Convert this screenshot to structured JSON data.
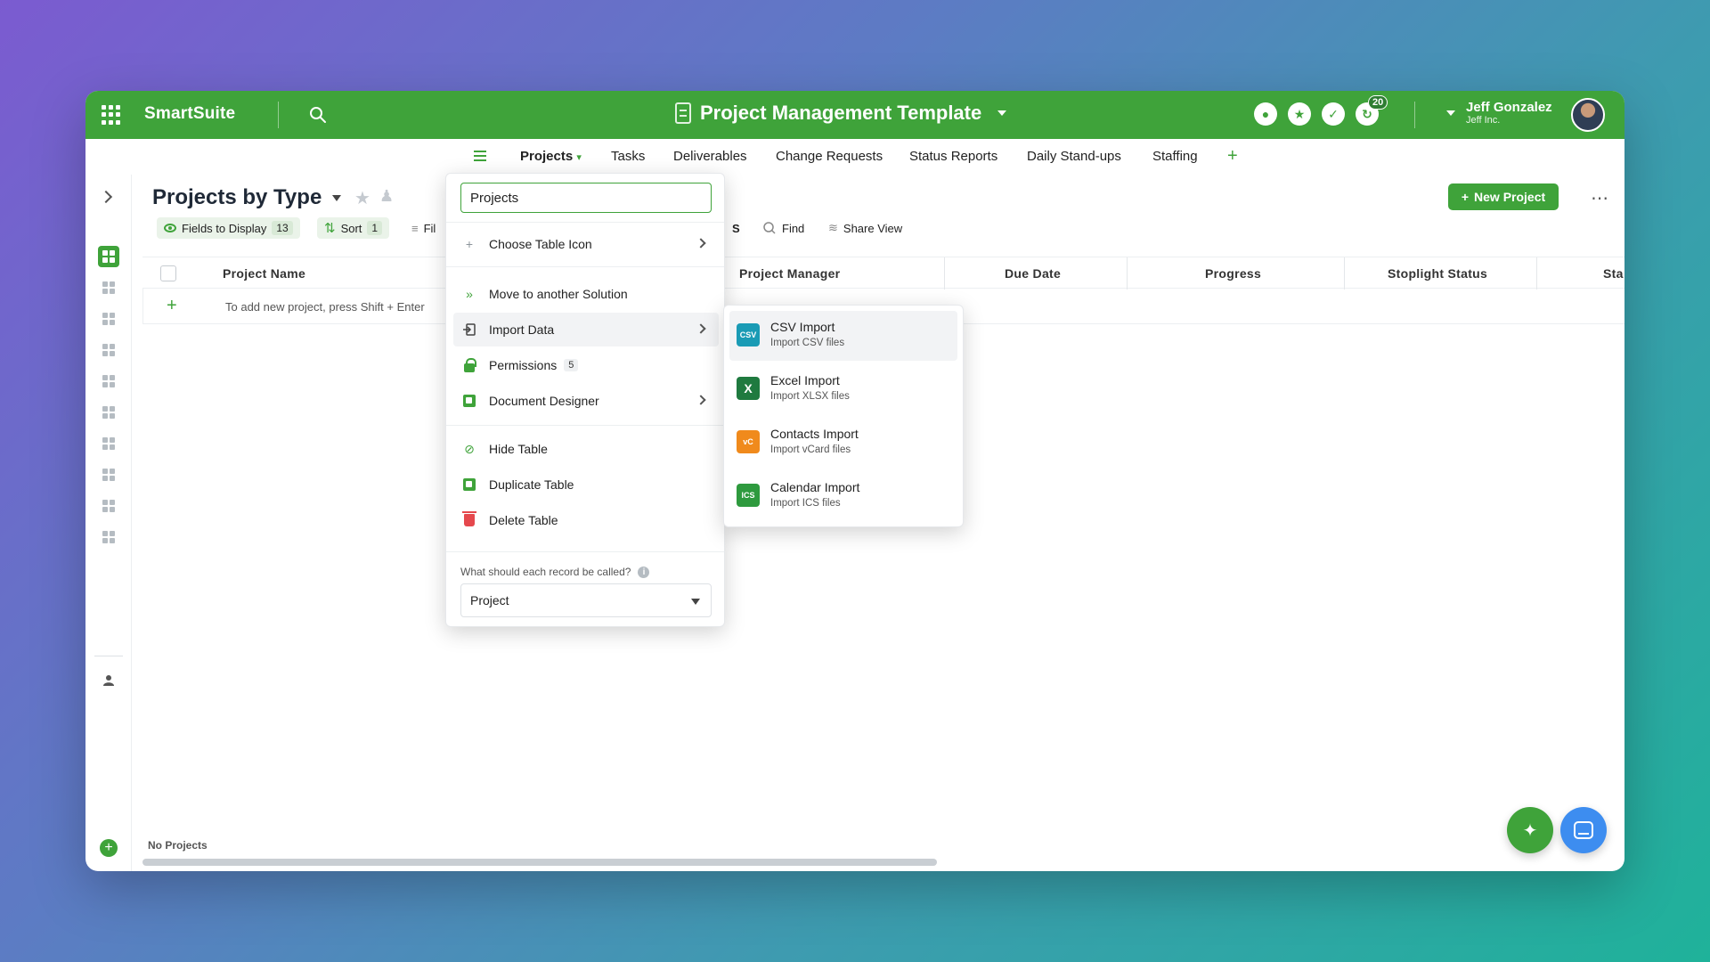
{
  "header": {
    "brand": "SmartSuite",
    "title": "Project Management Template",
    "notification_count": "20",
    "user_name": "Jeff Gonzalez",
    "user_org": "Jeff Inc.",
    "accent": "#3fa33a"
  },
  "tabs": [
    {
      "label": "Projects"
    },
    {
      "label": "Tasks"
    },
    {
      "label": "Deliverables"
    },
    {
      "label": "Change Requests"
    },
    {
      "label": "Status Reports"
    },
    {
      "label": "Daily Stand-ups"
    },
    {
      "label": "Staffing"
    }
  ],
  "view": {
    "title": "Projects by Type",
    "toolbar": {
      "fields_label": "Fields to Display",
      "fields_count": "13",
      "sort_label": "Sort",
      "sort_count": "1",
      "filter_label": "Fil",
      "s_label": "S",
      "find_label": "Find",
      "share_label": "Share View"
    },
    "new_button": "New Project"
  },
  "grid": {
    "columns": [
      "Project Name",
      "Project Manager",
      "Due Date",
      "Progress",
      "Stoplight Status",
      "Sta"
    ],
    "add_hint": "To add new project, press Shift + Enter",
    "footer_status": "No Projects"
  },
  "menu": {
    "table_name": "Projects",
    "items": [
      {
        "label": "Choose Table Icon"
      },
      {
        "label": "Move to another Solution"
      },
      {
        "label": "Import Data"
      },
      {
        "label": "Permissions",
        "count": "5"
      },
      {
        "label": "Document Designer"
      },
      {
        "label": "Hide Table"
      },
      {
        "label": "Duplicate Table"
      },
      {
        "label": "Delete Table"
      }
    ],
    "record_question": "What should each record be called?",
    "record_value": "Project"
  },
  "submenu": {
    "items": [
      {
        "title": "CSV Import",
        "subtitle": "Import CSV files",
        "badge": "CSV",
        "color": "#1a9bb5"
      },
      {
        "title": "Excel Import",
        "subtitle": "Import XLSX files",
        "badge": "X",
        "color": "#1f7a3f"
      },
      {
        "title": "Contacts Import",
        "subtitle": "Import vCard files",
        "badge": "vC",
        "color": "#f08a1c"
      },
      {
        "title": "Calendar Import",
        "subtitle": "Import ICS files",
        "badge": "ICS",
        "color": "#2e9a3e"
      }
    ]
  }
}
